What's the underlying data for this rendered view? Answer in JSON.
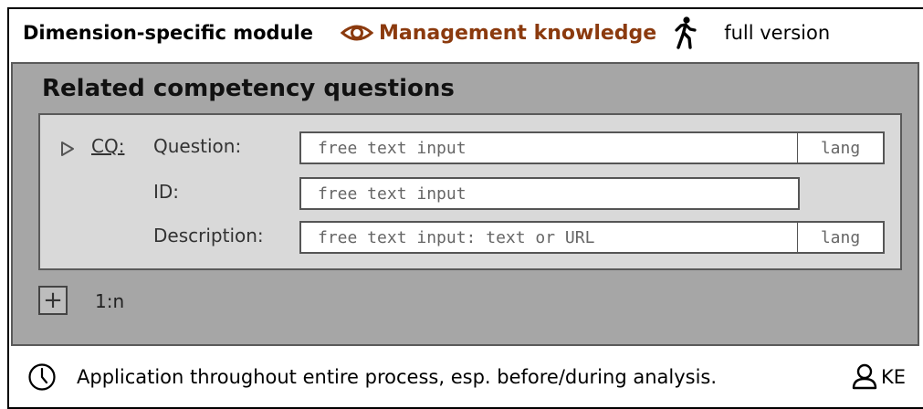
{
  "header": {
    "module_title": "Dimension-specific module",
    "topic": "Management knowledge",
    "version": "full version",
    "topic_color": "#8b3a0e",
    "icons": [
      "eye-icon",
      "walking-person-icon"
    ]
  },
  "section": {
    "title": "Related competency questions",
    "cq_link": "CQ:",
    "fields": [
      {
        "label": "Question:",
        "placeholder": "free text input",
        "lang": "lang"
      },
      {
        "label": "ID:",
        "placeholder": "free text input",
        "lang": ""
      },
      {
        "label": "Description:",
        "placeholder": "free text input: text or URL",
        "lang": "lang"
      }
    ],
    "add_label": "+",
    "cardinality": "1:n"
  },
  "footer": {
    "text": "Application throughout entire process, esp. before/during analysis.",
    "role": "KE",
    "icons": [
      "clock-icon",
      "person-icon"
    ]
  },
  "colors": {
    "outer_panel": "#a6a6a6",
    "inner_panel": "#d9d9d9"
  }
}
